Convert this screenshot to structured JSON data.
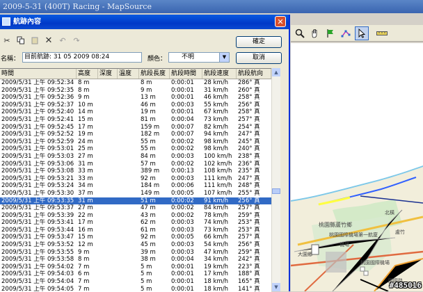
{
  "app": {
    "title": "2009-5-31 (400T) Racing - MapSource",
    "watermark": "#485016"
  },
  "map_toolbar": {
    "icons": [
      "zoom-icon",
      "hand-icon",
      "route-icon",
      "select-arrow-icon",
      "measure-icon"
    ]
  },
  "map": {
    "labels": [
      "桃園縣蘆竹鄉",
      "桃園國際機場第一航廈",
      "機場",
      "大園鄉",
      "北橫",
      "桃園國際機場",
      "國際路",
      "盧竹"
    ]
  },
  "dialog": {
    "title": "航跡內容",
    "ok_label": "確定",
    "cancel_label": "取消",
    "name_label": "名稱：",
    "name_value": "目前航跡: 31 05 2009 08:24",
    "color_label": "顏色：",
    "color_value": "不明",
    "toolbar_icons": [
      "cut-icon",
      "copy-icon",
      "paste-icon",
      "delete-icon",
      "undo-icon",
      "redo-icon"
    ]
  },
  "table": {
    "columns": [
      "時間",
      "高度",
      "深度",
      "溫度",
      "航段長度",
      "航段時間",
      "航段速度",
      "航段航向"
    ],
    "selected_index": 16,
    "rows": [
      [
        "2009/5/31 上午 09:52:34",
        "8 m",
        "",
        "",
        "8 m",
        "0:00:01",
        "28 km/h",
        "286° 真"
      ],
      [
        "2009/5/31 上午 09:52:35",
        "8 m",
        "",
        "",
        "9 m",
        "0:00:01",
        "31 km/h",
        "260° 真"
      ],
      [
        "2009/5/31 上午 09:52:36",
        "9 m",
        "",
        "",
        "13 m",
        "0:00:01",
        "46 km/h",
        "258° 真"
      ],
      [
        "2009/5/31 上午 09:52:37",
        "10 m",
        "",
        "",
        "46 m",
        "0:00:03",
        "55 km/h",
        "256° 真"
      ],
      [
        "2009/5/31 上午 09:52:40",
        "14 m",
        "",
        "",
        "19 m",
        "0:00:01",
        "67 km/h",
        "258° 真"
      ],
      [
        "2009/5/31 上午 09:52:41",
        "15 m",
        "",
        "",
        "81 m",
        "0:00:04",
        "73 km/h",
        "257° 真"
      ],
      [
        "2009/5/31 上午 09:52:45",
        "17 m",
        "",
        "",
        "159 m",
        "0:00:07",
        "82 km/h",
        "254° 真"
      ],
      [
        "2009/5/31 上午 09:52:52",
        "19 m",
        "",
        "",
        "182 m",
        "0:00:07",
        "94 km/h",
        "247° 真"
      ],
      [
        "2009/5/31 上午 09:52:59",
        "24 m",
        "",
        "",
        "55 m",
        "0:00:02",
        "98 km/h",
        "245° 真"
      ],
      [
        "2009/5/31 上午 09:53:01",
        "25 m",
        "",
        "",
        "55 m",
        "0:00:02",
        "98 km/h",
        "240° 真"
      ],
      [
        "2009/5/31 上午 09:53:03",
        "27 m",
        "",
        "",
        "84 m",
        "0:00:03",
        "100 km/h",
        "238° 真"
      ],
      [
        "2009/5/31 上午 09:53:06",
        "31 m",
        "",
        "",
        "57 m",
        "0:00:02",
        "102 km/h",
        "236° 真"
      ],
      [
        "2009/5/31 上午 09:53:08",
        "33 m",
        "",
        "",
        "389 m",
        "0:00:13",
        "108 km/h",
        "235° 真"
      ],
      [
        "2009/5/31 上午 09:53:21",
        "33 m",
        "",
        "",
        "92 m",
        "0:00:03",
        "111 km/h",
        "247° 真"
      ],
      [
        "2009/5/31 上午 09:53:24",
        "34 m",
        "",
        "",
        "184 m",
        "0:00:06",
        "111 km/h",
        "248° 真"
      ],
      [
        "2009/5/31 上午 09:53:30",
        "37 m",
        "",
        "",
        "149 m",
        "0:00:05",
        "107 km/h",
        "255° 真"
      ],
      [
        "2009/5/31 上午 09:53:35",
        "31 m",
        "",
        "",
        "51 m",
        "0:00:02",
        "91 km/h",
        "256° 真"
      ],
      [
        "2009/5/31 上午 09:53:37",
        "27 m",
        "",
        "",
        "47 m",
        "0:00:02",
        "84 km/h",
        "257° 真"
      ],
      [
        "2009/5/31 上午 09:53:39",
        "22 m",
        "",
        "",
        "43 m",
        "0:00:02",
        "78 km/h",
        "259° 真"
      ],
      [
        "2009/5/31 上午 09:53:41",
        "17 m",
        "",
        "",
        "62 m",
        "0:00:03",
        "74 km/h",
        "253° 真"
      ],
      [
        "2009/5/31 上午 09:53:44",
        "16 m",
        "",
        "",
        "61 m",
        "0:00:03",
        "73 km/h",
        "253° 真"
      ],
      [
        "2009/5/31 上午 09:53:47",
        "15 m",
        "",
        "",
        "92 m",
        "0:00:05",
        "66 km/h",
        "257° 真"
      ],
      [
        "2009/5/31 上午 09:53:52",
        "12 m",
        "",
        "",
        "45 m",
        "0:00:03",
        "54 km/h",
        "256° 真"
      ],
      [
        "2009/5/31 上午 09:53:55",
        "9 m",
        "",
        "",
        "39 m",
        "0:00:03",
        "47 km/h",
        "259° 真"
      ],
      [
        "2009/5/31 上午 09:53:58",
        "8 m",
        "",
        "",
        "38 m",
        "0:00:04",
        "34 km/h",
        "242° 真"
      ],
      [
        "2009/5/31 上午 09:54:02",
        "7 m",
        "",
        "",
        "5 m",
        "0:00:01",
        "19 km/h",
        "223° 真"
      ],
      [
        "2009/5/31 上午 09:54:03",
        "6 m",
        "",
        "",
        "5 m",
        "0:00:01",
        "17 km/h",
        "188° 真"
      ],
      [
        "2009/5/31 上午 09:54:04",
        "7 m",
        "",
        "",
        "5 m",
        "0:00:01",
        "18 km/h",
        "165° 真"
      ],
      [
        "2009/5/31 上午 09:54:05",
        "7 m",
        "",
        "",
        "5 m",
        "0:00:01",
        "18 km/h",
        "141° 真"
      ]
    ]
  }
}
